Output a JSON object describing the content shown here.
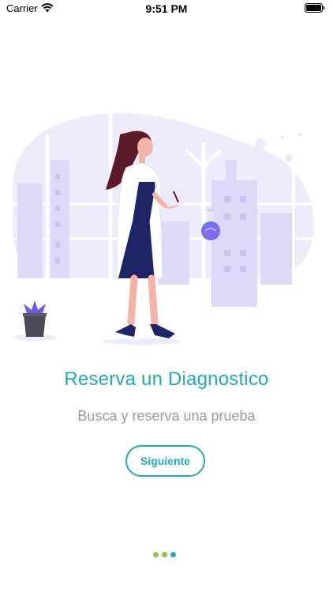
{
  "status_bar": {
    "carrier": "Carrier",
    "time": "9:51 PM",
    "wifi_icon": "wifi-icon",
    "battery_icon": "battery-icon"
  },
  "onboarding": {
    "illustration": "doctor-with-flask-illustration",
    "title": "Reserva un Diagnostico",
    "subtitle": "Busca y reserva una prueba",
    "next_button_label": "Siguiente",
    "page_indicator": {
      "total": 3,
      "current": 3
    }
  },
  "colors": {
    "accent": "#22aab3",
    "subtitle": "#9a9a9a",
    "illustration_bg": "#eeebfb",
    "dot_inactive": "#8cc63f",
    "dot_active": "#22aab3"
  }
}
